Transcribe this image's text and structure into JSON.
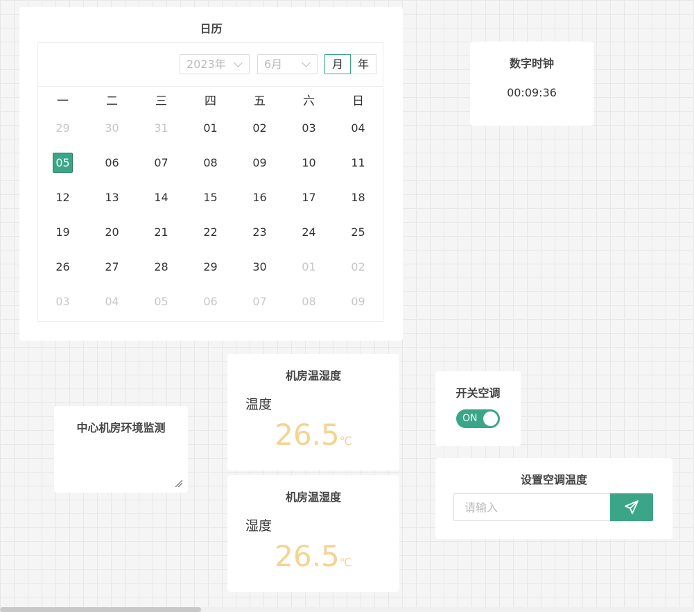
{
  "calendar": {
    "title": "日历",
    "year_value": "2023年",
    "month_value": "6月",
    "mode_month": "月",
    "mode_year": "年",
    "weekdays": [
      "一",
      "二",
      "三",
      "四",
      "五",
      "六",
      "日"
    ],
    "weeks": [
      [
        {
          "d": "29",
          "other": true
        },
        {
          "d": "30",
          "other": true
        },
        {
          "d": "31",
          "other": true
        },
        {
          "d": "01"
        },
        {
          "d": "02"
        },
        {
          "d": "03"
        },
        {
          "d": "04"
        }
      ],
      [
        {
          "d": "05",
          "today": true
        },
        {
          "d": "06"
        },
        {
          "d": "07"
        },
        {
          "d": "08"
        },
        {
          "d": "09"
        },
        {
          "d": "10"
        },
        {
          "d": "11"
        }
      ],
      [
        {
          "d": "12"
        },
        {
          "d": "13"
        },
        {
          "d": "14"
        },
        {
          "d": "15"
        },
        {
          "d": "16"
        },
        {
          "d": "17"
        },
        {
          "d": "18"
        }
      ],
      [
        {
          "d": "19"
        },
        {
          "d": "20"
        },
        {
          "d": "21"
        },
        {
          "d": "22"
        },
        {
          "d": "23"
        },
        {
          "d": "24"
        },
        {
          "d": "25"
        }
      ],
      [
        {
          "d": "26"
        },
        {
          "d": "27"
        },
        {
          "d": "28"
        },
        {
          "d": "29"
        },
        {
          "d": "30"
        },
        {
          "d": "01",
          "other": true
        },
        {
          "d": "02",
          "other": true
        }
      ],
      [
        {
          "d": "03",
          "other": true
        },
        {
          "d": "04",
          "other": true
        },
        {
          "d": "05",
          "other": true
        },
        {
          "d": "06",
          "other": true
        },
        {
          "d": "07",
          "other": true
        },
        {
          "d": "08",
          "other": true
        },
        {
          "d": "09",
          "other": true
        }
      ]
    ]
  },
  "clock": {
    "title": "数字时钟",
    "time": "00:09:36"
  },
  "env": {
    "title": "中心机房环境监测"
  },
  "temperature": {
    "title": "机房温湿度",
    "label": "温度",
    "value": "26.5",
    "unit": "℃"
  },
  "humidity": {
    "title": "机房温湿度",
    "label": "湿度",
    "value": "26.5",
    "unit": "℃"
  },
  "ac_switch": {
    "title": "开关空调",
    "state_text": "ON"
  },
  "set_temp": {
    "title": "设置空调温度",
    "placeholder": "请输入"
  },
  "icons": {
    "send": "send-icon",
    "chevron": "chevron-down-icon",
    "resize": "resize-grip-icon"
  },
  "colors": {
    "accent": "#3aa687",
    "value": "#f5d391"
  }
}
